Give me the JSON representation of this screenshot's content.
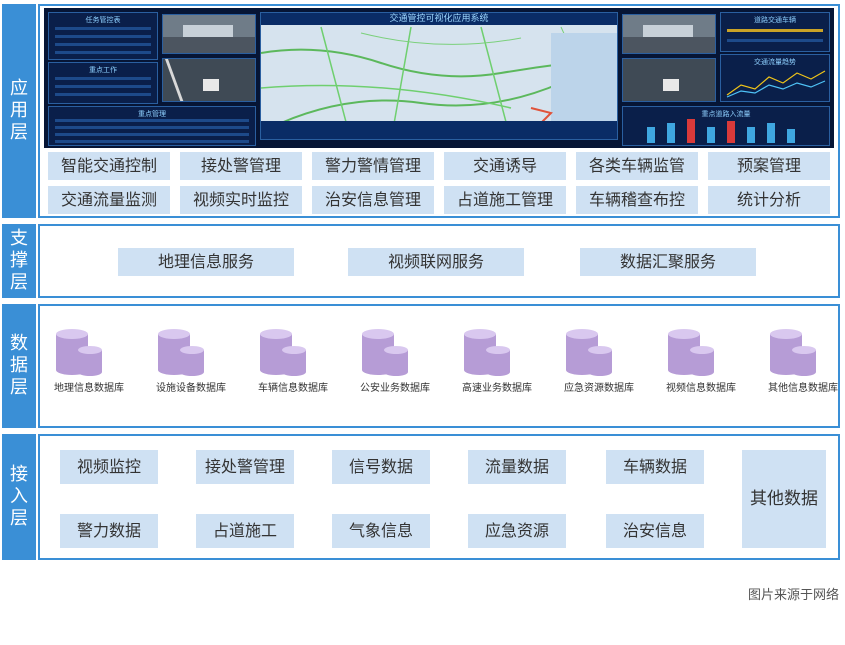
{
  "layers": {
    "application": {
      "label": "应用层",
      "dashboard_title": "交通管控可视化应用系统",
      "panels": {
        "task": "任务管控表",
        "work": "重点工作",
        "alarm": "重点管理",
        "stats": "道路交通车辆",
        "flow": "交通流量趋势",
        "rank": "重点道路入流量"
      },
      "buttons_row1": [
        "智能交通控制",
        "接处警管理",
        "警力警情管理",
        "交通诱导",
        "各类车辆监管",
        "预案管理"
      ],
      "buttons_row2": [
        "交通流量监测",
        "视频实时监控",
        "治安信息管理",
        "占道施工管理",
        "车辆稽查布控",
        "统计分析"
      ]
    },
    "support": {
      "label": "支撑层",
      "services": [
        "地理信息服务",
        "视频联网服务",
        "数据汇聚服务"
      ]
    },
    "data": {
      "label": "数据层",
      "databases": [
        "地理信息数据库",
        "设施设备数据库",
        "车辆信息数据库",
        "公安业务数据库",
        "高速业务数据库",
        "应急资源数据库",
        "视频信息数据库",
        "其他信息数据库"
      ]
    },
    "access": {
      "label": "接入层",
      "row1": [
        "视频监控",
        "接处警管理",
        "信号数据",
        "流量数据",
        "车辆数据"
      ],
      "row2": [
        "警力数据",
        "占道施工",
        "气象信息",
        "应急资源",
        "治安信息"
      ],
      "other": "其他数据"
    }
  },
  "source_note": "图片来源于网络",
  "colors": {
    "accent": "#3a8fd6",
    "button_fill": "#cfe1f3",
    "cylinder": "#b69cd6",
    "dashboard_bg": "#0a1f4a"
  }
}
